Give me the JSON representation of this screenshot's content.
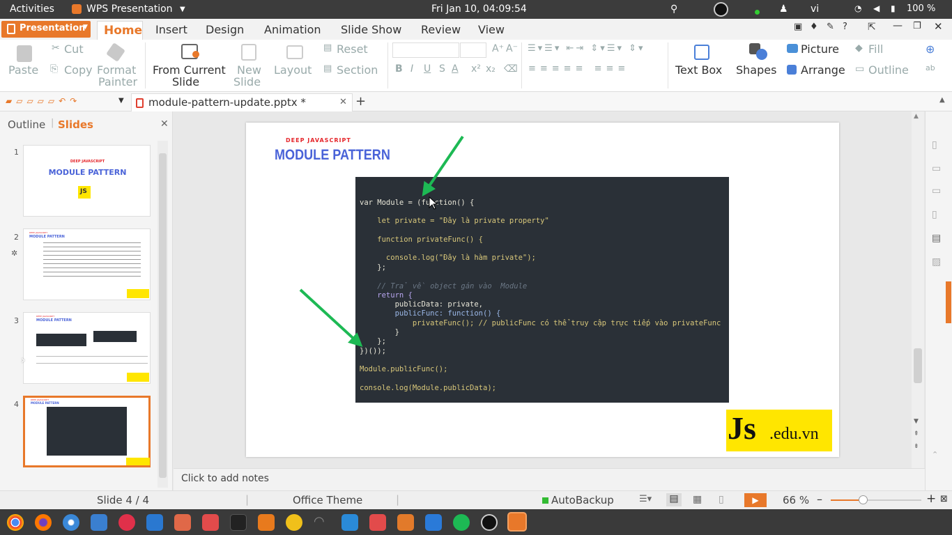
{
  "topbar": {
    "activities": "Activities",
    "app_name": "WPS Presentation",
    "clock": "Fri Jan 10, 04:09:54",
    "language": "vi",
    "battery": "100 %"
  },
  "ribbon": {
    "presentation_button": "Presentation",
    "tabs": [
      "Home",
      "Insert",
      "Design",
      "Animation",
      "Slide Show",
      "Review",
      "View"
    ],
    "active_tab": "Home"
  },
  "toolbar": {
    "paste": "Paste",
    "cut": "Cut",
    "copy": "Copy",
    "format_painter_1": "Format",
    "format_painter_2": "Painter",
    "from_current_1": "From Current",
    "from_current_2": "Slide",
    "new_slide_1": "New",
    "new_slide_2": "Slide",
    "layout": "Layout",
    "reset": "Reset",
    "section": "Section",
    "font_size_up": "A⁺",
    "font_size_down": "A⁻",
    "text_box": "Text Box",
    "shapes": "Shapes",
    "picture": "Picture",
    "arrange": "Arrange",
    "fill": "Fill",
    "outline": "Outline"
  },
  "document": {
    "filename": "module-pattern-update.pptx *"
  },
  "left_panel": {
    "outline_tab": "Outline",
    "slides_tab": "Slides",
    "thumbnails": [
      {
        "num": "1",
        "subtitle": "DEEP JAVASCRIPT",
        "title": "MODULE PATTERN"
      },
      {
        "num": "2",
        "subtitle": "DEEP JAVASCRIPT",
        "title": "MODULE PATTERN"
      },
      {
        "num": "3",
        "subtitle": "DEEP JAVASCRIPT",
        "title": "MODULE PATTERN"
      },
      {
        "num": "4",
        "subtitle": "DEEP JAVASCRIPT",
        "title": "MODULE PATTERN"
      }
    ]
  },
  "slide": {
    "subtitle": "DEEP JAVASCRIPT",
    "title": "MODULE PATTERN",
    "logo_js": "Js",
    "logo_domain": ".edu.vn",
    "code": [
      "var Module = (function() {",
      "",
      "    let private = \"Đây là private property\"",
      "",
      "    function privateFunc() {",
      "",
      "      console.log(\"Đây là hàm private\");",
      "    };",
      "",
      "    // Trả về object gán vào  Module",
      "    return {",
      "        publicData: private,",
      "        publicFunc: function() {",
      "            privateFunc(); // publicFunc có thể truy cập trực tiếp vào privateFunc",
      "        }",
      "    };",
      "})());",
      "",
      "Module.publicFunc();",
      "",
      "console.log(Module.publicData);"
    ]
  },
  "notes": {
    "placeholder": "Click to add notes"
  },
  "statusbar": {
    "slide_counter": "Slide 4 / 4",
    "theme": "Office Theme",
    "autobackup": "AutoBackup",
    "zoom": "66 %"
  },
  "colors": {
    "accent": "#e8782a",
    "title_blue": "#4a63d8",
    "subtitle_red": "#e5252a",
    "code_bg": "#2a3037",
    "arrow_green": "#1db954"
  }
}
